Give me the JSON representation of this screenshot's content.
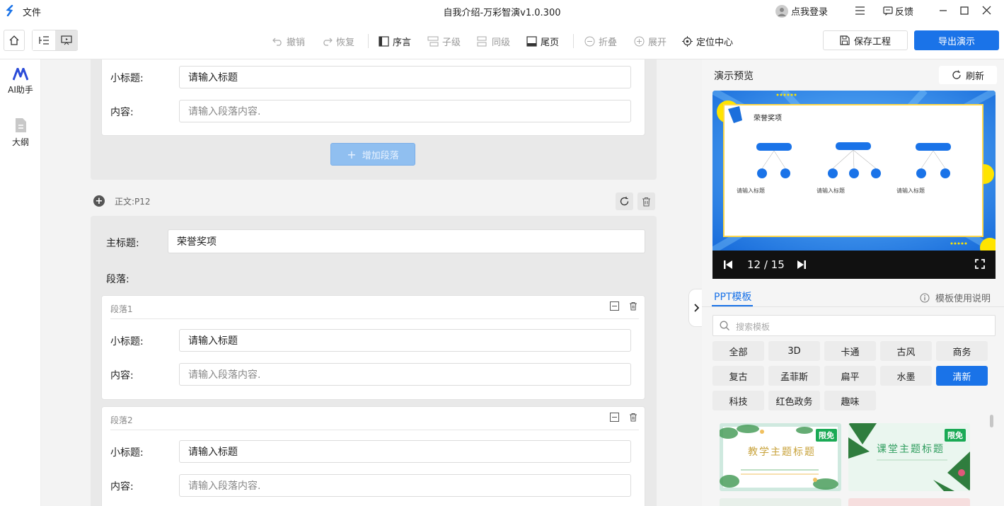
{
  "titlebar": {
    "file_menu": "文件",
    "title": "自我介绍-万彩智演v1.0.300",
    "login": "点我登录",
    "feedback": "反馈"
  },
  "toolbar": {
    "undo": "撤销",
    "redo": "恢复",
    "preface": "序言",
    "child": "子级",
    "sibling": "同级",
    "tail": "尾页",
    "collapse": "折叠",
    "expand": "展开",
    "locate_center": "定位中心",
    "save_project": "保存工程",
    "export": "导出演示"
  },
  "rail": {
    "ai_assistant": "AI助手",
    "outline": "大纲"
  },
  "editor": {
    "prev_card": {
      "subtitle_label": "小标题:",
      "subtitle_value": "请输入标题",
      "content_label": "内容:",
      "content_placeholder": "请输入段落内容."
    },
    "add_paragraph": "增加段落",
    "section_label": "正文:P12",
    "main_title_label": "主标题:",
    "main_title_value": "荣誉奖项",
    "paragraphs_label": "段落:",
    "paragraphs": [
      {
        "name": "段落1",
        "subtitle_label": "小标题:",
        "subtitle_value": "请输入标题",
        "content_label": "内容:",
        "content_placeholder": "请输入段落内容."
      },
      {
        "name": "段落2",
        "subtitle_label": "小标题:",
        "subtitle_value": "请输入标题",
        "content_label": "内容:",
        "content_placeholder": "请输入段落内容."
      }
    ]
  },
  "preview": {
    "heading": "演示预览",
    "refresh": "刷新",
    "slide_title": "荣誉奖项",
    "slide_items": [
      "请输入标题",
      "请输入标题",
      "请输入标题"
    ],
    "page_counter": "12 / 15"
  },
  "templates": {
    "tab": "PPT模板",
    "help": "模板使用说明",
    "search_placeholder": "搜索模板",
    "tags": [
      {
        "label": "全部",
        "active": false
      },
      {
        "label": "3D",
        "active": false
      },
      {
        "label": "卡通",
        "active": false
      },
      {
        "label": "古风",
        "active": false
      },
      {
        "label": "商务",
        "active": false
      },
      {
        "label": "复古",
        "active": false
      },
      {
        "label": "孟菲斯",
        "active": false
      },
      {
        "label": "扁平",
        "active": false
      },
      {
        "label": "水墨",
        "active": false
      },
      {
        "label": "清新",
        "active": true
      },
      {
        "label": "科技",
        "active": false
      },
      {
        "label": "红色政务",
        "active": false
      },
      {
        "label": "趣味",
        "active": false
      }
    ],
    "cards": [
      {
        "title": "教学主题标题",
        "badge": "限免"
      },
      {
        "title": "课堂主题标题",
        "badge": "限免"
      }
    ]
  },
  "colors": {
    "accent": "#1a73e8",
    "badge": "#1aaa55"
  }
}
